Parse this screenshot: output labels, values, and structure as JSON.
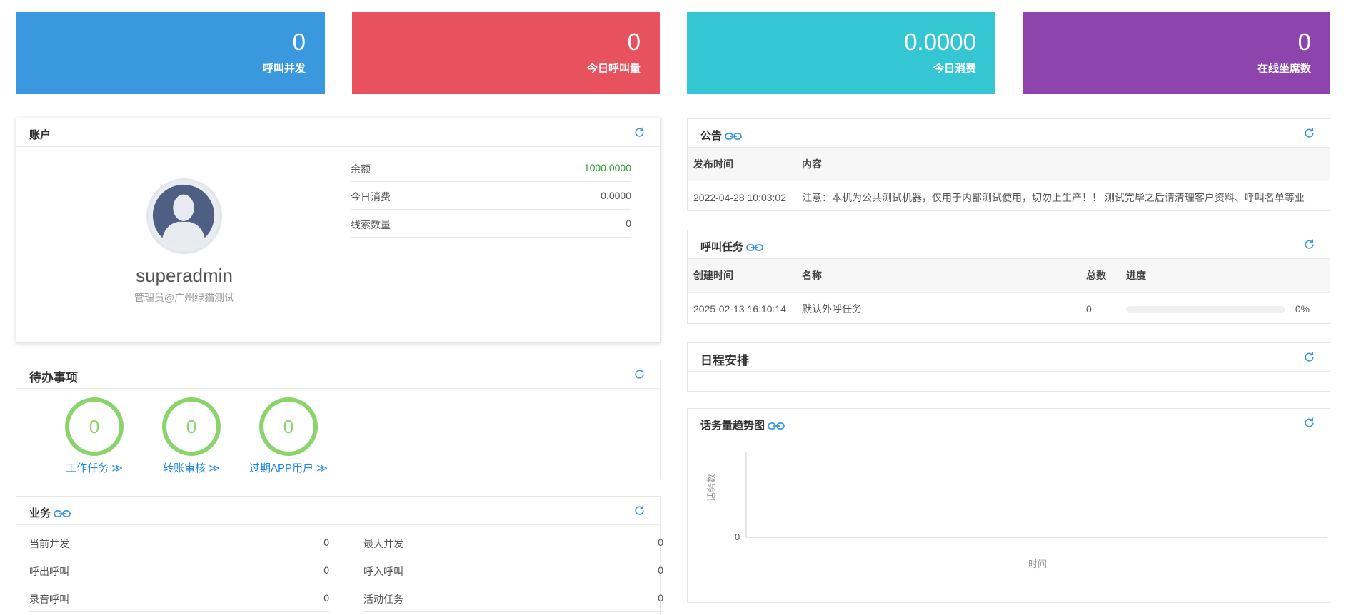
{
  "stats": [
    {
      "value": "0",
      "label": "呼叫并发",
      "color": "#3a99de"
    },
    {
      "value": "0",
      "label": "今日呼叫量",
      "color": "#e8515e"
    },
    {
      "value": "0.0000",
      "label": "今日消费",
      "color": "#35c6d4"
    },
    {
      "value": "0",
      "label": "在线坐席数",
      "color": "#8e44ad"
    }
  ],
  "account": {
    "title": "账户",
    "username": "superadmin",
    "role": "管理员@广州绿猫测试",
    "rows": [
      {
        "label": "余额",
        "value": "1000.0000",
        "value_color": "#2e9d2e"
      },
      {
        "label": "今日消费",
        "value": "0.0000"
      },
      {
        "label": "线索数量",
        "value": "0"
      }
    ]
  },
  "todo": {
    "title": "待办事项",
    "items": [
      {
        "count": "0",
        "label": "工作任务 ≫"
      },
      {
        "count": "0",
        "label": "转账审核 ≫"
      },
      {
        "count": "0",
        "label": "过期APP用户 ≫"
      }
    ]
  },
  "business": {
    "title": "业务",
    "left": [
      {
        "label": "当前并发",
        "value": "0"
      },
      {
        "label": "呼出呼叫",
        "value": "0"
      },
      {
        "label": "录音呼叫",
        "value": "0"
      }
    ],
    "right": [
      {
        "label": "最大并发",
        "value": "0"
      },
      {
        "label": "呼入呼叫",
        "value": "0"
      },
      {
        "label": "活动任务",
        "value": "0"
      }
    ]
  },
  "notice": {
    "title": "公告",
    "headers": [
      "发布时间",
      "内容"
    ],
    "rows": [
      {
        "time": "2022-04-28 10:03:02",
        "content": "注意：本机为公共测试机器，仅用于内部测试使用，切勿上生产！！ 测试完毕之后请清理客户资料、呼叫名单等业"
      }
    ]
  },
  "tasks": {
    "title": "呼叫任务",
    "headers": [
      "创建时间",
      "名称",
      "总数",
      "进度"
    ],
    "rows": [
      {
        "time": "2025-02-13 16:10:14",
        "name": "默认外呼任务",
        "total": "0",
        "progress": 0,
        "progress_text": "0%"
      }
    ]
  },
  "schedule": {
    "title": "日程安排"
  },
  "trend": {
    "title": "话务量趋势图"
  },
  "chart_data": {
    "type": "line",
    "title": "",
    "xlabel": "时间",
    "ylabel": "话务数",
    "x": [],
    "series": [],
    "y_ticks": [
      "0"
    ],
    "grid": false
  }
}
